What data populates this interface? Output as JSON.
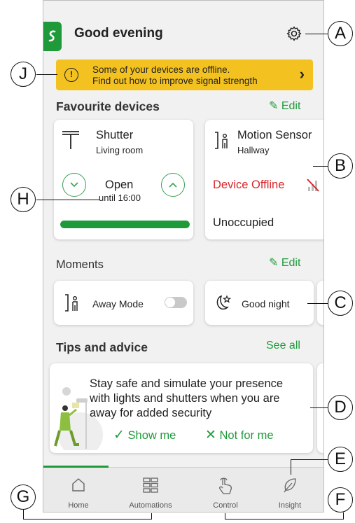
{
  "header": {
    "greeting": "Good evening"
  },
  "banner": {
    "line1": "Some of your devices are offline.",
    "line2": "Find out how to improve signal strength"
  },
  "favourites": {
    "title": "Favourite devices",
    "edit_label": "Edit",
    "shutter": {
      "name": "Shutter",
      "room": "Living room",
      "state": "Open",
      "until": "until 16:00",
      "progress": 1.0
    },
    "motion": {
      "name": "Motion Sensor",
      "room": "Hallway",
      "status": "Device Offline",
      "state": "Unoccupied"
    }
  },
  "moments": {
    "title": "Moments",
    "edit_label": "Edit",
    "items": [
      {
        "label": "Away Mode",
        "toggle_on": false
      },
      {
        "label": "Good night"
      }
    ]
  },
  "tips": {
    "title": "Tips and advice",
    "see_all": "See all",
    "card": {
      "line1": "Stay safe and simulate your presence",
      "line2": "with lights and shutters when you are",
      "line3": "away for added security",
      "show_me": "Show me",
      "not_for_me": "Not for me"
    }
  },
  "nav": {
    "items": [
      {
        "label": "Home",
        "active": true
      },
      {
        "label": "Automations"
      },
      {
        "label": "Control"
      },
      {
        "label": "Insight"
      }
    ]
  },
  "callouts": [
    "A",
    "B",
    "C",
    "D",
    "E",
    "F",
    "G",
    "H",
    "J"
  ],
  "colors": {
    "accent": "#1f9a3a",
    "warning": "#f4c220",
    "offline": "#d9262b"
  }
}
